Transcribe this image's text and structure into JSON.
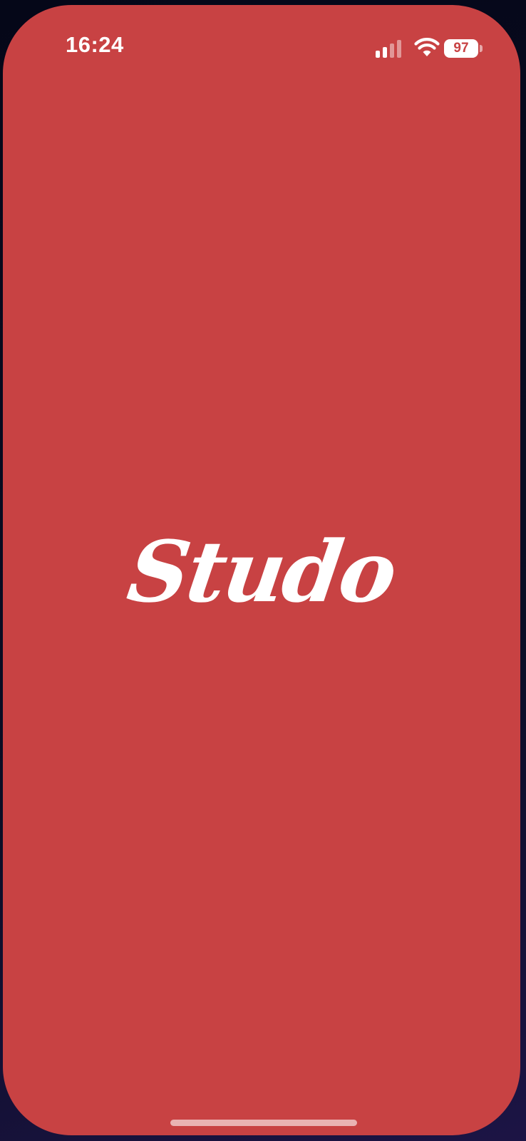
{
  "status_bar": {
    "time": "16:24",
    "battery_level": "97",
    "signal_icon": "cellular-signal-icon",
    "wifi_icon": "wifi-icon",
    "battery_icon": "battery-icon",
    "signal_bars_active": 2,
    "signal_bars_total": 4
  },
  "splash": {
    "logo_text": "Studo",
    "background_color": "#c84243",
    "logo_color": "#ffffff"
  }
}
